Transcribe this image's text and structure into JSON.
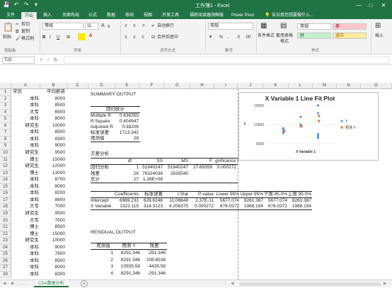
{
  "titlebar": {
    "title": "工作簿1 - Excel",
    "qa_save": "💾",
    "qa_undo": "↶",
    "qa_redo": "↷",
    "qa_more": "▾",
    "min": "—",
    "max": "□",
    "close": "✕"
  },
  "ribbon_tabs": [
    "文件",
    "开始",
    "插入",
    "页面布局",
    "公式",
    "数据",
    "审阅",
    "视图",
    "开发工具",
    "福昕阅读器领鲜版",
    "Power Pivot"
  ],
  "tell_me": "告诉我您想要做什么...",
  "ribbon": {
    "paste": "粘贴",
    "cut": "剪切",
    "copy": "复制",
    "format_painter": "格式刷",
    "font_name": "等线",
    "font_size": "11",
    "bold": "B",
    "italic": "I",
    "underline": "U",
    "grow": "A",
    "shrink": "A",
    "wrap_text": "自动换行",
    "merge_center": "合并后居中",
    "number_format": "常规",
    "percent": "%",
    "comma": ",",
    "cond_format": "条件格式",
    "table_format": "套用表格格式",
    "style_normal": "常规",
    "style_bad": "差",
    "style_good": "好",
    "style_neutral": "适中",
    "insert": "插入",
    "group_clipboard": "剪贴板",
    "group_font": "字体",
    "group_align": "对齐方式",
    "group_number": "数字",
    "group_styles": "样式"
  },
  "formula_bar": {
    "name_box": "T15",
    "fx": "fx",
    "value": ""
  },
  "columns": [
    "A",
    "B",
    "C",
    "D",
    "E",
    "F",
    "G",
    "H",
    "I",
    "J",
    "K",
    "L",
    "M",
    "N",
    "O"
  ],
  "row_numbers": [
    "1",
    "2",
    "3",
    "4",
    "5",
    "6",
    "7",
    "8",
    "9",
    "10",
    "11",
    "12",
    "13",
    "14",
    "15",
    "16",
    "17",
    "18",
    "19",
    "20",
    "21",
    "22",
    "23",
    "24",
    "25",
    "26",
    "27",
    "28"
  ],
  "col_a": [
    "学历",
    "本科",
    "本科",
    "大专",
    "本科",
    "研究生",
    "本科",
    "本科",
    "本科",
    "研究生",
    "博士",
    "研究生",
    "博士",
    "本科",
    "本科",
    "本科",
    "本科",
    "大专",
    "研究生",
    "大专",
    "博士",
    "博士",
    "研究生",
    "本科",
    "本科",
    "本科",
    "本科",
    "本科"
  ],
  "col_b": [
    "平均薪资",
    "8000",
    "8500",
    "6500",
    "8000",
    "10000",
    "8500",
    "8300",
    "9000",
    "9500",
    "15000",
    "12000",
    "13000",
    "8700",
    "8000",
    "8200",
    "8600",
    "7000",
    "9500",
    "7500",
    "8500",
    "15000",
    "10000",
    "9000",
    "7800",
    "8500",
    "8000",
    "8300"
  ],
  "summary": {
    "title": "SUMMARY OUTPUT",
    "reg_stats_title": "回归统计",
    "reg_stats": [
      {
        "label": "Multiple R",
        "value": "0.636355"
      },
      {
        "label": "R Square",
        "value": "0.404947"
      },
      {
        "label": "Adjusted R",
        "value": "0.38206"
      },
      {
        "label": "标准误差",
        "value": "1713.342"
      },
      {
        "label": "观测值",
        "value": "28"
      }
    ],
    "anova_title": "方差分析",
    "anova_header": [
      "df",
      "SS",
      "MS",
      "F",
      "gnificance F"
    ],
    "anova_rows": [
      {
        "label": "回归分析",
        "df": "1",
        "ss": "51940247",
        "ms": "51940247",
        "f": "17.69359",
        "sig": "0.000272"
      },
      {
        "label": "残差",
        "df": "26",
        "ss": "76324038",
        "ms": "2935540",
        "f": "",
        "sig": ""
      },
      {
        "label": "总计",
        "df": "27",
        "ss": "1.28E+08",
        "ms": "",
        "f": "",
        "sig": ""
      }
    ],
    "coef_header": [
      "Coefficients",
      "标准误差",
      "t Stat",
      "P-value",
      "Lower 95%",
      "Upper 95%",
      "下限 95.0%",
      "上限 95.0%"
    ],
    "coef_rows": [
      {
        "label": "Intercept",
        "vals": [
          "6969.231",
          "628.6246",
          "11.08648",
          "2.37E-11",
          "5677.074",
          "8261.387",
          "5677.074",
          "8261.387"
        ]
      },
      {
        "label": "X Variable",
        "vals": [
          "1322.115",
          "314.3123",
          "4.206375",
          "0.000272",
          "676.0372",
          "1968.194",
          "676.0372",
          "1968.194"
        ]
      }
    ],
    "residual_title": "RESIDUAL OUTPUT",
    "residual_header": [
      "观测值",
      "预测 Y",
      "残差"
    ],
    "residual_rows": [
      [
        "1",
        "8291.346",
        "-291.346"
      ],
      [
        "2",
        "8291.346",
        "208.6538"
      ],
      [
        "3",
        "10935.58",
        "-4435.58"
      ],
      [
        "4",
        "8291.346",
        "-291.346"
      ]
    ]
  },
  "chart_data": {
    "type": "scatter",
    "title": "X Variable 1 Line Fit  Plot",
    "xlabel": "X Variable 1",
    "ylabel": "Y",
    "yticks": [
      "15000",
      "10000",
      "5000"
    ],
    "ylim": [
      5000,
      15000
    ],
    "xlim": [
      0,
      4
    ],
    "legend_position": "right",
    "series": [
      {
        "name": "Y",
        "color": "#5b9bd5",
        "points": [
          [
            1,
            8000
          ],
          [
            1,
            8500
          ],
          [
            3,
            6500
          ],
          [
            1,
            8000
          ],
          [
            2,
            10000
          ],
          [
            1,
            8500
          ],
          [
            1,
            8300
          ],
          [
            1,
            9000
          ],
          [
            2,
            9500
          ],
          [
            3,
            15000
          ],
          [
            2,
            12000
          ],
          [
            3,
            13000
          ],
          [
            1,
            8700
          ],
          [
            1,
            8000
          ],
          [
            1,
            8200
          ],
          [
            1,
            8600
          ],
          [
            3,
            7000
          ],
          [
            2,
            9500
          ],
          [
            3,
            7500
          ],
          [
            1,
            8500
          ],
          [
            3,
            15000
          ],
          [
            2,
            10000
          ],
          [
            1,
            9000
          ],
          [
            1,
            7800
          ],
          [
            1,
            8500
          ],
          [
            1,
            8000
          ],
          [
            1,
            8300
          ]
        ]
      },
      {
        "name": "预测 Y",
        "color": "#ed7d31",
        "points": [
          [
            1,
            8291
          ],
          [
            2,
            9613
          ],
          [
            3,
            10936
          ],
          [
            3,
            12258
          ]
        ]
      }
    ]
  },
  "sheet_tab": "CDA数据分析",
  "add_sheet": "+"
}
